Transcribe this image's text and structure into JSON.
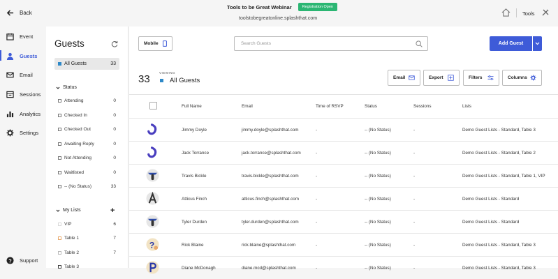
{
  "topbar": {
    "back_label": "Back",
    "webinar_title": "Tools to be Great Webinar",
    "registration_badge": "Registration Open",
    "site_url": "toolstobegreatonline.splashthat.com",
    "tools_label": "Tools"
  },
  "nav": {
    "items": [
      {
        "label": "Event",
        "icon": "calendar-icon"
      },
      {
        "label": "Guests",
        "icon": "person-icon",
        "active": true
      },
      {
        "label": "Email",
        "icon": "envelope-icon"
      },
      {
        "label": "Sessions",
        "icon": "sessions-icon"
      },
      {
        "label": "Analytics",
        "icon": "bar-chart-icon"
      },
      {
        "label": "Settings",
        "icon": "gear-icon"
      }
    ],
    "support_label": "Support"
  },
  "panel": {
    "title": "Guests",
    "all_guests": {
      "label": "All Guests",
      "count": "33"
    },
    "status_heading": "Status",
    "status_filters": [
      {
        "label": "Attending",
        "count": "0"
      },
      {
        "label": "Checked In",
        "count": "0"
      },
      {
        "label": "Checked Out",
        "count": "0"
      },
      {
        "label": "Awaiting Reply",
        "count": "0"
      },
      {
        "label": "Not Attending",
        "count": "0"
      },
      {
        "label": "Waitlisted",
        "count": "0"
      },
      {
        "label": "-- (No Status)",
        "count": "33"
      }
    ],
    "lists_heading": "My Lists",
    "lists": [
      {
        "label": "VIP",
        "count": "6",
        "color": "#d9d9d9"
      },
      {
        "label": "Table 1",
        "count": "7",
        "color": "#e8a86b"
      },
      {
        "label": "Table 2",
        "count": "7",
        "color": "#b8b8b8"
      },
      {
        "label": "Table 3",
        "count": "",
        "color": "#3a3a3a"
      }
    ]
  },
  "toolbar": {
    "mobile_label": "Mobile",
    "search_placeholder": "Search Guests",
    "add_guest_label": "Add Guest",
    "accent_color": "#3e5bd8"
  },
  "summary": {
    "count": "33",
    "viewing_label": "VIEWING",
    "viewing_value": "All Guests"
  },
  "actions": {
    "email": "Email",
    "export": "Export",
    "filters": "Filters",
    "columns": "Columns"
  },
  "table": {
    "columns": [
      "Full Name",
      "Email",
      "Time of RSVP",
      "Status",
      "Sessions",
      "Lists"
    ],
    "rows": [
      {
        "name": "Jimmy Doyle",
        "email": "jimmy.doyle@splashthat.com",
        "rsvp": "-",
        "status": "-- (No Status)",
        "sessions": "-",
        "lists": "Demo Guest Lists - Standard, Table 3",
        "avatar": "j"
      },
      {
        "name": "Jack Torrance",
        "email": "jack.torrance@splashthat.com",
        "rsvp": "-",
        "status": "-- (No Status)",
        "sessions": "-",
        "lists": "Demo Guest Lists - Standard, Table 2",
        "avatar": "j"
      },
      {
        "name": "Travis Bickle",
        "email": "travis.bickle@splashthat.com",
        "rsvp": "-",
        "status": "-- (No Status)",
        "sessions": "-",
        "lists": "Demo Guest Lists - Standard, Table 1, VIP",
        "avatar": "t"
      },
      {
        "name": "Atticus Finch",
        "email": "atticus.finch@splashthat.com",
        "rsvp": "-",
        "status": "-- (No Status)",
        "sessions": "-",
        "lists": "Demo Guest Lists - Standard",
        "avatar": "a"
      },
      {
        "name": "Tyler Durden",
        "email": "tyler.durden@splashthat.com",
        "rsvp": "-",
        "status": "-- (No Status)",
        "sessions": "-",
        "lists": "Demo Guest Lists - Standard",
        "avatar": "t"
      },
      {
        "name": "Rick Blaine",
        "email": "rick.blaine@splashthat.com",
        "rsvp": "-",
        "status": "-- (No Status)",
        "sessions": "-",
        "lists": "Demo Guest Lists - Standard, Table 3",
        "avatar": "q"
      },
      {
        "name": "Diane McDonagh",
        "email": "diane.mcd@splashthat.com",
        "rsvp": "-",
        "status": "-- (No Status)",
        "sessions": "-",
        "lists": "Demo Guest Lists - Standard, Table 3",
        "avatar": "p"
      }
    ]
  }
}
